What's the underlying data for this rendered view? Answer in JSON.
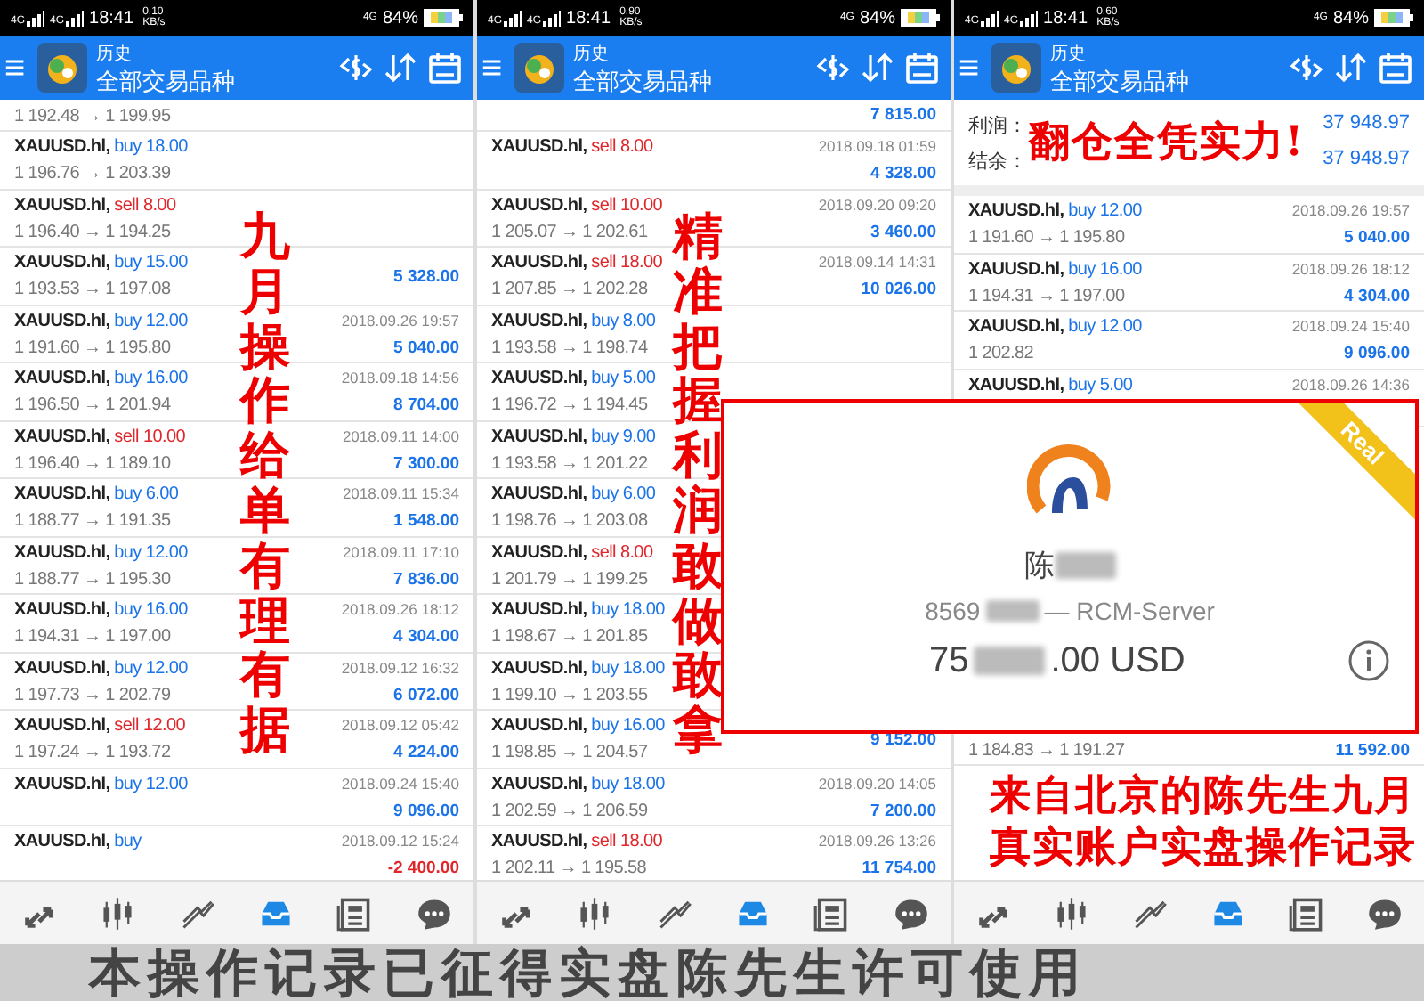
{
  "panels": [
    {
      "status": {
        "networks": [
          "4G",
          "4G"
        ],
        "time": "18:41",
        "speed": "0.10",
        "speed_unit": "KB/s",
        "right_network": "4G",
        "battery": "84%"
      },
      "header": {
        "subtitle": "历史",
        "title": "全部交易品种"
      },
      "entries": [
        {
          "kind": "trade",
          "price": "1 192.48 → 1 199.95"
        },
        {
          "kind": "trade",
          "symbol": "XAUUSD.hl,",
          "side": {
            "kind": "buy",
            "text": "buy 18.00"
          },
          "price": "1 196.76 → 1 203.39"
        },
        {
          "kind": "trade",
          "symbol": "XAUUSD.hl,",
          "side": {
            "kind": "sell",
            "text": "sell 8.00"
          },
          "price": "1 196.40 → 1 194.25"
        },
        {
          "kind": "trade",
          "symbol": "XAUUSD.hl,",
          "side": {
            "kind": "buy",
            "text": "buy 15.00"
          },
          "price": "1 193.53 → 1 197.08",
          "amount": "5 328.00",
          "loss": false
        },
        {
          "kind": "trade",
          "symbol": "XAUUSD.hl,",
          "side": {
            "kind": "buy",
            "text": "buy 12.00"
          },
          "price": "1 191.60 → 1 195.80",
          "date": "2018.09.26 19:57",
          "amount": "5 040.00",
          "loss": false
        },
        {
          "kind": "trade",
          "symbol": "XAUUSD.hl,",
          "side": {
            "kind": "buy",
            "text": "buy 16.00"
          },
          "price": "1 196.50 → 1 201.94",
          "date": "2018.09.18 14:56",
          "amount": "8 704.00",
          "loss": false
        },
        {
          "kind": "trade",
          "symbol": "XAUUSD.hl,",
          "side": {
            "kind": "sell",
            "text": "sell 10.00"
          },
          "price": "1 196.40 → 1 189.10",
          "date": "2018.09.11 14:00",
          "amount": "7 300.00",
          "loss": false
        },
        {
          "kind": "trade",
          "symbol": "XAUUSD.hl,",
          "side": {
            "kind": "buy",
            "text": "buy 6.00"
          },
          "price": "1 188.77 → 1 191.35",
          "date": "2018.09.11 15:34",
          "amount": "1 548.00",
          "loss": false
        },
        {
          "kind": "trade",
          "symbol": "XAUUSD.hl,",
          "side": {
            "kind": "buy",
            "text": "buy 12.00"
          },
          "price": "1 188.77 → 1 195.30",
          "date": "2018.09.11 17:10",
          "amount": "7 836.00",
          "loss": false
        },
        {
          "kind": "trade",
          "symbol": "XAUUSD.hl,",
          "side": {
            "kind": "buy",
            "text": "buy 16.00"
          },
          "price": "1 194.31 → 1 197.00",
          "date": "2018.09.26 18:12",
          "amount": "4 304.00",
          "loss": false
        },
        {
          "kind": "trade",
          "symbol": "XAUUSD.hl,",
          "side": {
            "kind": "buy",
            "text": "buy 12.00"
          },
          "price": "1 197.73 → 1 202.79",
          "date": "2018.09.12 16:32",
          "amount": "6 072.00",
          "loss": false
        },
        {
          "kind": "trade",
          "symbol": "XAUUSD.hl,",
          "side": {
            "kind": "sell",
            "text": "sell 12.00"
          },
          "price": "1 197.24 → 1 193.72",
          "date": "2018.09.12 05:42",
          "amount": "4 224.00",
          "loss": false
        },
        {
          "kind": "trade",
          "symbol": "XAUUSD.hl,",
          "side": {
            "kind": "buy",
            "text": "buy 12.00"
          },
          "date": "2018.09.24 15:40",
          "amount": "9 096.00",
          "loss": false
        },
        {
          "kind": "trade",
          "symbol": "XAUUSD.hl,",
          "side": {
            "kind": "buy",
            "text": "buy"
          },
          "date": "2018.09.12 15:24",
          "amount": "-2 400.00",
          "loss": true
        }
      ],
      "overlay_caption": "九月操作给单有理有据",
      "nav": [
        {
          "kind": "quotes",
          "selected": false
        },
        {
          "kind": "chart",
          "selected": false
        },
        {
          "kind": "trade",
          "selected": false
        },
        {
          "kind": "history",
          "selected": true
        },
        {
          "kind": "news",
          "selected": false
        },
        {
          "kind": "chat",
          "selected": false
        }
      ]
    },
    {
      "status": {
        "networks": [
          "4G",
          "4G"
        ],
        "time": "18:41",
        "speed": "0.90",
        "speed_unit": "KB/s",
        "right_network": "4G",
        "battery": "84%"
      },
      "header": {
        "subtitle": "历史",
        "title": "全部交易品种"
      },
      "entries": [
        {
          "kind": "trade",
          "amount": "7 815.00",
          "loss": false
        },
        {
          "kind": "trade",
          "symbol": "XAUUSD.hl,",
          "side": {
            "kind": "sell",
            "text": "sell 8.00"
          },
          "date": "2018.09.18 01:59",
          "amount": "4 328.00",
          "loss": false
        },
        {
          "kind": "trade",
          "symbol": "XAUUSD.hl,",
          "side": {
            "kind": "sell",
            "text": "sell 10.00"
          },
          "price": "1 205.07 → 1 202.61",
          "date": "2018.09.20 09:20",
          "amount": "3 460.00",
          "loss": false
        },
        {
          "kind": "trade",
          "symbol": "XAUUSD.hl,",
          "side": {
            "kind": "sell",
            "text": "sell 18.00"
          },
          "price": "1 207.85 → 1 202.28",
          "date": "2018.09.14 14:31",
          "amount": "10 026.00",
          "loss": false
        },
        {
          "kind": "trade",
          "symbol": "XAUUSD.hl,",
          "side": {
            "kind": "buy",
            "text": "buy 8.00"
          },
          "price": "1 193.58 → 1 198.74"
        },
        {
          "kind": "trade",
          "symbol": "XAUUSD.hl,",
          "side": {
            "kind": "buy",
            "text": "buy 5.00"
          },
          "price": "1 196.72 → 1 194.45"
        },
        {
          "kind": "trade",
          "symbol": "XAUUSD.hl,",
          "side": {
            "kind": "buy",
            "text": "buy 9.00"
          },
          "price": "1 193.58 → 1 201.22"
        },
        {
          "kind": "trade",
          "symbol": "XAUUSD.hl,",
          "side": {
            "kind": "buy",
            "text": "buy 6.00"
          },
          "price": "1 198.76 → 1 203.08"
        },
        {
          "kind": "trade",
          "symbol": "XAUUSD.hl,",
          "side": {
            "kind": "sell",
            "text": "sell 8.00"
          },
          "price": "1 201.79 → 1 199.25"
        },
        {
          "kind": "trade",
          "symbol": "XAUUSD.hl,",
          "side": {
            "kind": "buy",
            "text": "buy 18.00"
          },
          "price": "1 198.67 → 1 201.85"
        },
        {
          "kind": "trade",
          "symbol": "XAUUSD.hl,",
          "side": {
            "kind": "buy",
            "text": "buy 18.00"
          },
          "price": "1 199.10 → 1 203.55"
        },
        {
          "kind": "trade",
          "symbol": "XAUUSD.hl,",
          "side": {
            "kind": "buy",
            "text": "buy 16.00"
          },
          "price": "1 198.85 → 1 204.57",
          "amount": "9 152.00",
          "loss": false
        },
        {
          "kind": "trade",
          "symbol": "XAUUSD.hl,",
          "side": {
            "kind": "buy",
            "text": "buy 18.00"
          },
          "price": "1 202.59 → 1 206.59",
          "date": "2018.09.20 14:05",
          "amount": "7 200.00",
          "loss": false
        },
        {
          "kind": "trade",
          "symbol": "XAUUSD.hl,",
          "side": {
            "kind": "sell",
            "text": "sell 18.00"
          },
          "price": "1 202.11 → 1 195.58",
          "date": "2018.09.26 13:26",
          "amount": "11 754.00",
          "loss": false
        }
      ],
      "overlay_caption": "精准把握利润敢做敢拿",
      "nav": [
        {
          "kind": "quotes",
          "selected": false
        },
        {
          "kind": "chart",
          "selected": false
        },
        {
          "kind": "trade",
          "selected": false
        },
        {
          "kind": "history",
          "selected": true
        },
        {
          "kind": "news",
          "selected": false
        },
        {
          "kind": "chat",
          "selected": false
        }
      ]
    },
    {
      "status": {
        "networks": [
          "4G",
          "4G"
        ],
        "time": "18:41",
        "speed": "0.60",
        "speed_unit": "KB/s",
        "right_network": "4G",
        "battery": "84%"
      },
      "header": {
        "subtitle": "历史",
        "title": "全部交易品种"
      },
      "summary": {
        "rows": [
          {
            "label": "利润：",
            "value": "37 948.97"
          },
          {
            "label": "结余：",
            "value": "37 948.97"
          }
        ],
        "caption": "翻仓全凭实力!"
      },
      "entries": [
        {
          "kind": "trade",
          "symbol": "XAUUSD.hl,",
          "side": {
            "kind": "buy",
            "text": "buy 12.00"
          },
          "price": "1 191.60 → 1 195.80",
          "date": "2018.09.26 19:57",
          "amount": "5 040.00",
          "loss": false
        },
        {
          "kind": "trade",
          "symbol": "XAUUSD.hl,",
          "side": {
            "kind": "buy",
            "text": "buy 16.00"
          },
          "price": "1 194.31 → 1 197.00",
          "date": "2018.09.26 18:12",
          "amount": "4 304.00",
          "loss": false
        },
        {
          "kind": "trade",
          "symbol": "XAUUSD.hl,",
          "side": {
            "kind": "buy",
            "text": "buy 12.00"
          },
          "price": "1 202.82",
          "date": "2018.09.24 15:40",
          "amount": "9 096.00",
          "loss": false
        },
        {
          "kind": "trade",
          "symbol": "XAUUSD.hl,",
          "side": {
            "kind": "buy",
            "text": "buy 5.00"
          },
          "date": "2018.09.26 14:36"
        },
        {
          "kind": "account_card",
          "badge": "Real",
          "name": "陈",
          "account": "8569",
          "server": "— RCM-Server",
          "balance_start": "75",
          "balance_end": ".00 USD"
        },
        {
          "kind": "trade",
          "price": "1 184.83 → 1 191.27",
          "amount": "11 592.00",
          "loss": false
        },
        {
          "kind": "caption",
          "lines": [
            "来自北京的陈先生九月",
            "真实账户实盘操作记录"
          ]
        }
      ],
      "nav": [
        {
          "kind": "quotes",
          "selected": false
        },
        {
          "kind": "chart",
          "selected": false
        },
        {
          "kind": "trade",
          "selected": false
        },
        {
          "kind": "history",
          "selected": true
        },
        {
          "kind": "news",
          "selected": false
        },
        {
          "kind": "chat",
          "selected": false
        }
      ]
    }
  ],
  "banner": "本操作记录已征得实盘陈先生许可使用"
}
